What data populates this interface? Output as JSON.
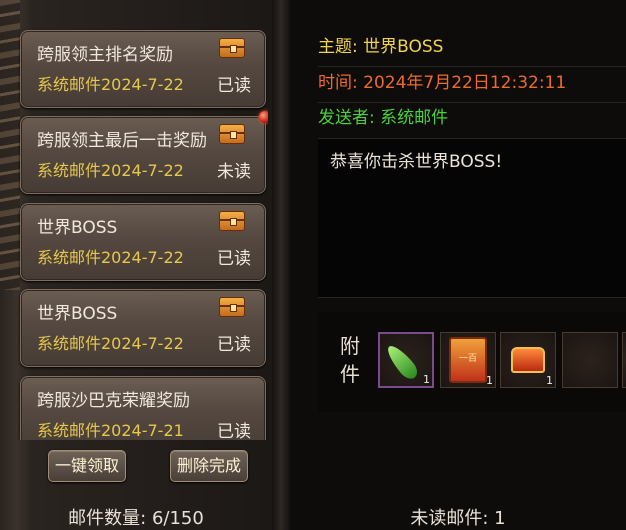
{
  "mail_list": [
    {
      "subject": "跨服领主排名奖励",
      "sender_date": "系统邮件2024-7-22",
      "status": "已读",
      "unread": false
    },
    {
      "subject": "跨服领主最后一击奖励",
      "sender_date": "系统邮件2024-7-22",
      "status": "未读",
      "unread": true
    },
    {
      "subject": "世界BOSS",
      "sender_date": "系统邮件2024-7-22",
      "status": "已读",
      "unread": false
    },
    {
      "subject": "世界BOSS",
      "sender_date": "系统邮件2024-7-22",
      "status": "已读",
      "unread": false
    },
    {
      "subject": "跨服沙巴克荣耀奖励",
      "sender_date": "系统邮件2024-7-21",
      "status": "已读",
      "unread": false
    }
  ],
  "buttons": {
    "claim_all": "一键领取",
    "delete_done": "删除完成"
  },
  "mail_count": "邮件数量: 6/150",
  "detail": {
    "subject": "主题: 世界BOSS",
    "time": "时间: 2024年7月22日12:32:11",
    "sender": "发送者: 系统邮件",
    "body": "恭喜你击杀世界BOSS!",
    "attachment_label_1": "附",
    "attachment_label_2": "件",
    "attachments": [
      {
        "name": "feather-icon",
        "count": "1"
      },
      {
        "name": "scroll-icon",
        "count": "1"
      },
      {
        "name": "treasure-chest-icon",
        "count": "1"
      }
    ]
  },
  "unread_count": "未读邮件: 1",
  "colors": {
    "subject": "#f0d44a",
    "time": "#ee6a2a",
    "sender": "#4ad13a",
    "list_date": "#e6c84c"
  }
}
